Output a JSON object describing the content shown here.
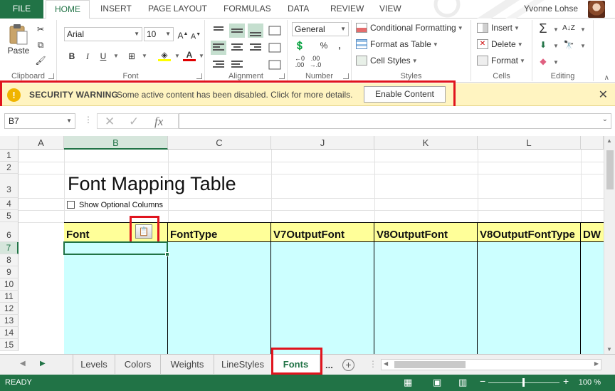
{
  "ribbon_tabs": {
    "file": "FILE",
    "home": "HOME",
    "insert": "INSERT",
    "page_layout": "PAGE LAYOUT",
    "formulas": "FORMULAS",
    "data": "DATA",
    "review": "REVIEW",
    "view": "VIEW"
  },
  "user": {
    "name": "Yvonne Lohse"
  },
  "clipboard": {
    "paste": "Paste",
    "label": "Clipboard"
  },
  "font": {
    "name": "Arial",
    "size": "10",
    "bold": "B",
    "italic": "I",
    "underline": "U",
    "label": "Font"
  },
  "alignment": {
    "label": "Alignment"
  },
  "number": {
    "format": "General",
    "label": "Number",
    "percent": "%",
    "comma": ","
  },
  "styles": {
    "conditional": "Conditional Formatting",
    "format_table": "Format as Table",
    "cell_styles": "Cell Styles",
    "label": "Styles"
  },
  "cells": {
    "insert": "Insert",
    "delete": "Delete",
    "format": "Format",
    "label": "Cells"
  },
  "editing": {
    "label": "Editing"
  },
  "security": {
    "title": "SECURITY WARNING",
    "message": "Some active content has been disabled. Click for more details.",
    "button": "Enable Content"
  },
  "formula_bar": {
    "name_box": "B7",
    "fx": "fx",
    "content": ""
  },
  "columns": [
    "A",
    "B",
    "C",
    "J",
    "K",
    "L"
  ],
  "rows": [
    "1",
    "2",
    "3",
    "4",
    "5",
    "6",
    "7",
    "8",
    "9",
    "10",
    "11",
    "12",
    "13",
    "14",
    "15"
  ],
  "sheet": {
    "title": "Font Mapping Table",
    "show_optional": "Show Optional Columns",
    "headers": [
      "Font",
      "FontType",
      "V7OutputFont",
      "V8OutputFont",
      "V8OutputFontType",
      "DW"
    ]
  },
  "sheet_tabs": [
    "Levels",
    "Colors",
    "Weights",
    "LineStyles",
    "Fonts"
  ],
  "active_sheet": "Fonts",
  "more_tabs": "...",
  "status": {
    "text": "READY",
    "zoom": "100 %"
  },
  "colors": {
    "accent": "#217346",
    "header_fill": "#ffff99",
    "data_fill": "#ccffff",
    "warning_bg": "#fff4c1",
    "highlight": "#e0141e"
  }
}
